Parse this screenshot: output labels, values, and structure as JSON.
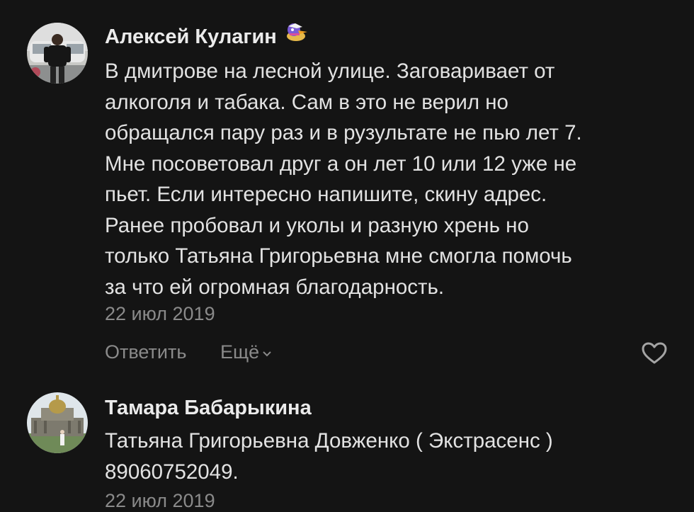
{
  "comments": [
    {
      "author": "Алексей Кулагин",
      "sticker": "duck-icon",
      "text_lines": [
        "В дмитрове на лесной улице. Заговаривает от",
        "алкоголя и табака. Сам в это не верил но",
        "обращался пару раз и в рузультате не пью лет 7.",
        "Мне посоветовал друг а он лет 10 или 12 уже не",
        "пьет. Если интересно напишите, скину адрес.",
        "Ранее пробовал и уколы и разную хрень но",
        "только Татьяна Григорьевна мне смогла помочь",
        "за что ей огромная благодарность."
      ],
      "date": "22 июл 2019",
      "reply_label": "Ответить",
      "more_label": "Ещё",
      "like_icon": "heart-icon"
    },
    {
      "author": "Тамара Бабарыкина",
      "text_lines": [
        "Татьяна Григорьевна Довженко ( Экстрасенс )",
        "89060752049."
      ],
      "date": "22 июл 2019"
    }
  ],
  "colors": {
    "background": "#141414",
    "text": "#e2e2e2",
    "muted": "#8a8a8a"
  }
}
